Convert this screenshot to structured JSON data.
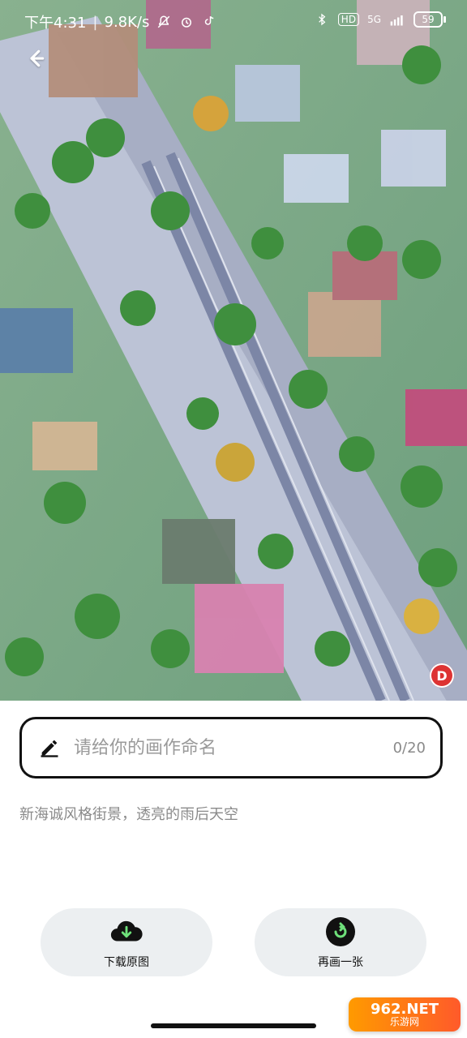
{
  "status": {
    "time": "下午4:31",
    "speed": "9.8K/s",
    "network": "5G",
    "hd": "HD",
    "battery": "59"
  },
  "icons": {
    "back": "back-arrow-icon",
    "pen": "pen-icon",
    "download": "download-cloud-icon",
    "redraw": "redraw-icon",
    "badge": "app-badge-icon"
  },
  "badge": {
    "text": "D"
  },
  "name_field": {
    "placeholder": "请给你的画作命名",
    "counter": "0/20"
  },
  "description": "新海诚风格街景，透亮的雨后天空",
  "actions": {
    "download_label": "下载原图",
    "redraw_label": "再画一张"
  },
  "watermark": {
    "line1": "962.NET",
    "line2": "乐游网"
  }
}
